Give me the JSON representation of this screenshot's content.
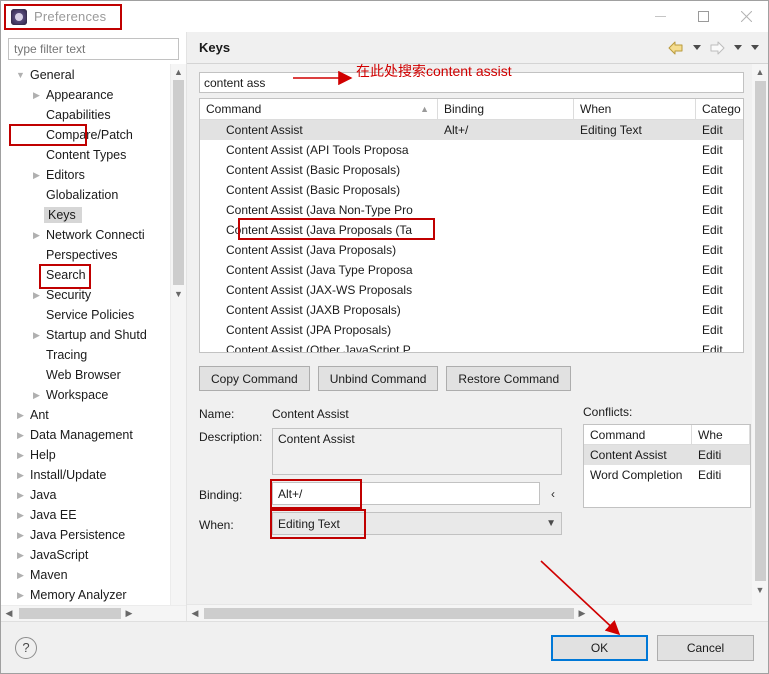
{
  "window": {
    "title": "Preferences",
    "icon": "preferences-icon",
    "minimize_label": "—",
    "maximize_label": "□",
    "close_label": "✕"
  },
  "sidebar": {
    "filter_placeholder": "type filter text",
    "filter_value": "",
    "items": [
      {
        "label": "General",
        "level": 1,
        "arrow": "expanded",
        "selected": false
      },
      {
        "label": "Appearance",
        "level": 2,
        "arrow": "collapsed",
        "selected": false
      },
      {
        "label": "Capabilities",
        "level": 2,
        "arrow": "none",
        "selected": false
      },
      {
        "label": "Compare/Patch",
        "level": 2,
        "arrow": "none",
        "selected": false
      },
      {
        "label": "Content Types",
        "level": 2,
        "arrow": "none",
        "selected": false
      },
      {
        "label": "Editors",
        "level": 2,
        "arrow": "collapsed",
        "selected": false
      },
      {
        "label": "Globalization",
        "level": 2,
        "arrow": "none",
        "selected": false
      },
      {
        "label": "Keys",
        "level": 2,
        "arrow": "none",
        "selected": true
      },
      {
        "label": "Network Connecti",
        "level": 2,
        "arrow": "collapsed",
        "selected": false
      },
      {
        "label": "Perspectives",
        "level": 2,
        "arrow": "none",
        "selected": false
      },
      {
        "label": "Search",
        "level": 2,
        "arrow": "none",
        "selected": false
      },
      {
        "label": "Security",
        "level": 2,
        "arrow": "collapsed",
        "selected": false
      },
      {
        "label": "Service Policies",
        "level": 2,
        "arrow": "none",
        "selected": false
      },
      {
        "label": "Startup and Shutd",
        "level": 2,
        "arrow": "collapsed",
        "selected": false
      },
      {
        "label": "Tracing",
        "level": 2,
        "arrow": "none",
        "selected": false
      },
      {
        "label": "Web Browser",
        "level": 2,
        "arrow": "none",
        "selected": false
      },
      {
        "label": "Workspace",
        "level": 2,
        "arrow": "collapsed",
        "selected": false
      },
      {
        "label": "Ant",
        "level": 1,
        "arrow": "collapsed",
        "selected": false
      },
      {
        "label": "Data Management",
        "level": 1,
        "arrow": "collapsed",
        "selected": false
      },
      {
        "label": "Help",
        "level": 1,
        "arrow": "collapsed",
        "selected": false
      },
      {
        "label": "Install/Update",
        "level": 1,
        "arrow": "collapsed",
        "selected": false
      },
      {
        "label": "Java",
        "level": 1,
        "arrow": "collapsed",
        "selected": false
      },
      {
        "label": "Java EE",
        "level": 1,
        "arrow": "collapsed",
        "selected": false
      },
      {
        "label": "Java Persistence",
        "level": 1,
        "arrow": "collapsed",
        "selected": false
      },
      {
        "label": "JavaScript",
        "level": 1,
        "arrow": "collapsed",
        "selected": false
      },
      {
        "label": "Maven",
        "level": 1,
        "arrow": "collapsed",
        "selected": false
      },
      {
        "label": "Memory Analyzer",
        "level": 1,
        "arrow": "collapsed",
        "selected": false
      }
    ]
  },
  "page": {
    "title": "Keys",
    "nav": {
      "back_icon": "back-arrow-icon",
      "back_dropdown_icon": "chevron-down-icon",
      "forward_icon": "forward-arrow-icon",
      "forward_dropdown_icon": "chevron-down-icon",
      "menu_icon": "chevron-down-icon"
    },
    "search": {
      "value": "content ass",
      "placeholder": "type filter text"
    },
    "table": {
      "columns": [
        "Command",
        "Binding",
        "When",
        "Catego"
      ],
      "sort_indicator": "▲",
      "rows": [
        {
          "command": "Content Assist",
          "binding": "Alt+/",
          "when": "Editing Text",
          "category": "Edit",
          "selected": true
        },
        {
          "command": "Content Assist (API Tools Proposa",
          "binding": "",
          "when": "",
          "category": "Edit",
          "selected": false
        },
        {
          "command": "Content Assist (Basic Proposals)",
          "binding": "",
          "when": "",
          "category": "Edit",
          "selected": false
        },
        {
          "command": "Content Assist (Basic Proposals)",
          "binding": "",
          "when": "",
          "category": "Edit",
          "selected": false
        },
        {
          "command": "Content Assist (Java Non-Type Pro",
          "binding": "",
          "when": "",
          "category": "Edit",
          "selected": false
        },
        {
          "command": "Content Assist (Java Proposals (Ta",
          "binding": "",
          "when": "",
          "category": "Edit",
          "selected": false
        },
        {
          "command": "Content Assist (Java Proposals)",
          "binding": "",
          "when": "",
          "category": "Edit",
          "selected": false
        },
        {
          "command": "Content Assist (Java Type Proposa",
          "binding": "",
          "when": "",
          "category": "Edit",
          "selected": false
        },
        {
          "command": "Content Assist (JAX-WS Proposals",
          "binding": "",
          "when": "",
          "category": "Edit",
          "selected": false
        },
        {
          "command": "Content Assist (JAXB Proposals)",
          "binding": "",
          "when": "",
          "category": "Edit",
          "selected": false
        },
        {
          "command": "Content Assist (JPA Proposals)",
          "binding": "",
          "when": "",
          "category": "Edit",
          "selected": false
        },
        {
          "command": "Content Assist (Other JavaScript P",
          "binding": "",
          "when": "",
          "category": "Edit",
          "selected": false
        }
      ]
    },
    "buttons": {
      "copy_command": "Copy Command",
      "unbind_command": "Unbind Command",
      "restore_command": "Restore Command"
    },
    "details": {
      "name_label": "Name:",
      "name_value": "Content Assist",
      "description_label": "Description:",
      "description_value": "Content Assist",
      "binding_label": "Binding:",
      "binding_value": "Alt+/",
      "binding_secondary_value": "",
      "binding_prev_icon": "‹",
      "when_label": "When:",
      "when_value": "Editing Text",
      "when_chevron": "chevron-down-icon"
    },
    "conflicts": {
      "label": "Conflicts:",
      "columns": [
        "Command",
        "Whe"
      ],
      "rows": [
        {
          "command": "Content Assist",
          "when": "Editi",
          "selected": true
        },
        {
          "command": "Word Completion",
          "when": "Editi",
          "selected": false
        }
      ]
    }
  },
  "footer": {
    "help_icon": "help-icon",
    "help_label": "?",
    "ok_label": "OK",
    "cancel_label": "Cancel"
  },
  "annotations": {
    "search_note": "在此处搜索content assist",
    "accent_color": "#d00000"
  }
}
